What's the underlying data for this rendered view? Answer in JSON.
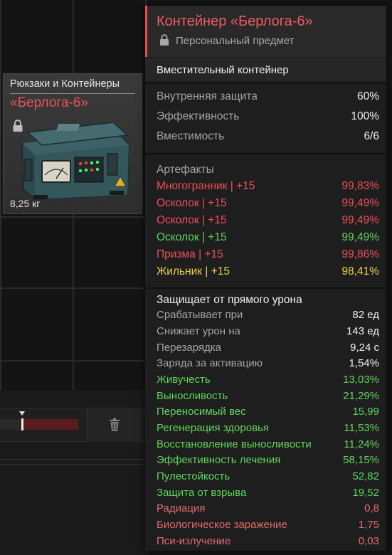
{
  "item_card": {
    "category": "Рюкзаки и Контейнеры",
    "name": "«Берлога-6»",
    "weight": "8,25 кг"
  },
  "tooltip": {
    "title": "Контейнер «Берлога-6»",
    "subtitle": "Персональный предмет",
    "type": "Вместительный контейнер",
    "base_stats": [
      {
        "label": "Внутренняя защита",
        "value": "60%"
      },
      {
        "label": "Эффективность",
        "value": "100%"
      },
      {
        "label": "Вместимость",
        "value": "6/6"
      }
    ],
    "artifacts_header": "Артефакты",
    "artifacts": [
      {
        "label": "Многогранник | +15",
        "value": "99,83%",
        "color": "#ef4f5a"
      },
      {
        "label": "Осколок | +15",
        "value": "99,49%",
        "color": "#ef4f5a"
      },
      {
        "label": "Осколок | +15",
        "value": "99,49%",
        "color": "#ef4f5a"
      },
      {
        "label": "Осколок | +15",
        "value": "99,49%",
        "color": "#5fd65c"
      },
      {
        "label": "Призма | +15",
        "value": "99,86%",
        "color": "#ef4f5a"
      },
      {
        "label": "Жильник | +15",
        "value": "98,41%",
        "color": "#ecd24a"
      }
    ],
    "effects_header": "Защищает от прямого урона",
    "effects": [
      {
        "label": "Срабатывает при",
        "value": "82 ед",
        "kind": "neutral"
      },
      {
        "label": "Снижает урон на",
        "value": "143 ед",
        "kind": "neutral"
      },
      {
        "label": "Перезарядка",
        "value": "9,24 с",
        "kind": "neutral"
      },
      {
        "label": "Заряда за активацию",
        "value": "1,54%",
        "kind": "neutral"
      },
      {
        "label": "Живучесть",
        "value": "13,03%",
        "kind": "positive"
      },
      {
        "label": "Выносливость",
        "value": "21,29%",
        "kind": "positive"
      },
      {
        "label": "Переносимый вес",
        "value": "15,99",
        "kind": "positive"
      },
      {
        "label": "Регенерация здоровья",
        "value": "11,53%",
        "kind": "positive"
      },
      {
        "label": "Восстановление выносливости",
        "value": "11,24%",
        "kind": "positive"
      },
      {
        "label": "Эффективность лечения",
        "value": "58,15%",
        "kind": "positive"
      },
      {
        "label": "Пулестойкость",
        "value": "52,82",
        "kind": "positive"
      },
      {
        "label": "Защита от взрыва",
        "value": "19,52",
        "kind": "positive"
      },
      {
        "label": "Радиация",
        "value": "0,8",
        "kind": "negative"
      },
      {
        "label": "Биологическое заражение",
        "value": "1,75",
        "kind": "negative"
      },
      {
        "label": "Пси-излучение",
        "value": "0,03",
        "kind": "negative"
      }
    ]
  },
  "toolbar": {
    "slider_fill": 0.27,
    "trash_icon": "trash-icon"
  },
  "colors": {
    "accent": "#f04a55",
    "positive": "#5fd65c",
    "negative": "#e36b6b",
    "legendary": "#ecd24a"
  }
}
